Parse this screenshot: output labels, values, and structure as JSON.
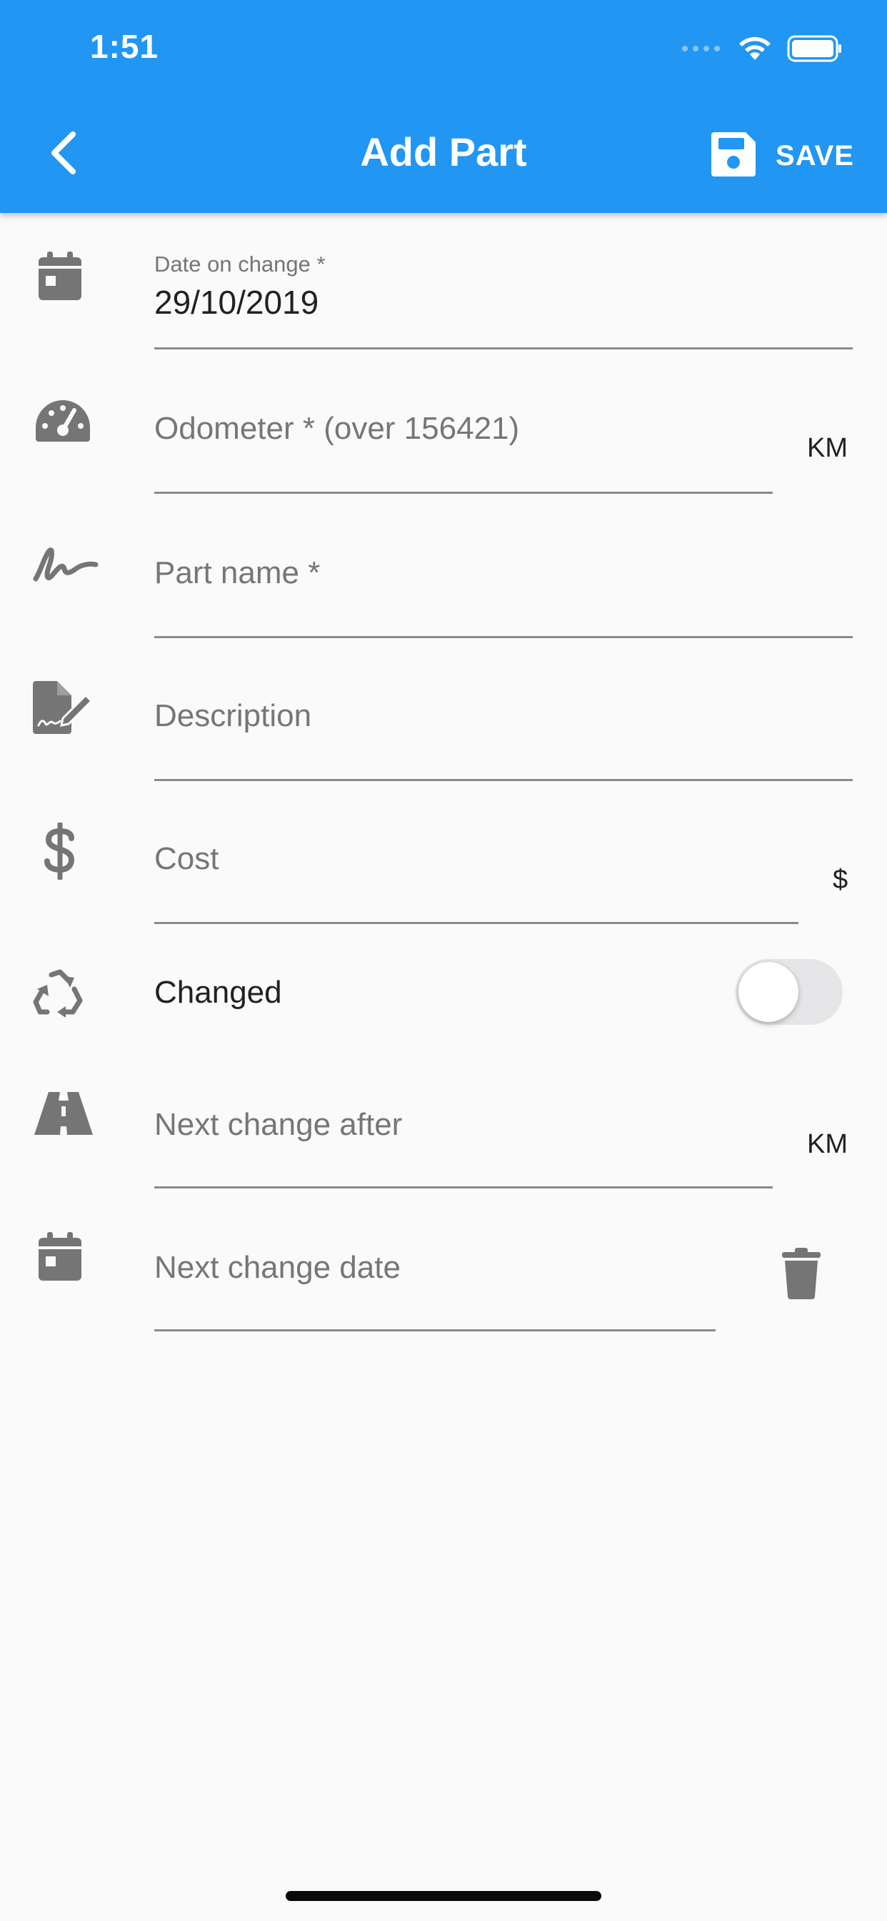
{
  "status_bar": {
    "time": "1:51"
  },
  "app_bar": {
    "title": "Add Part",
    "save_label": "SAVE",
    "back_icon": "chevron-left-icon",
    "save_icon": "floppy-disk-icon",
    "color": "#2196f3"
  },
  "form": {
    "date_on_change": {
      "label": "Date on change *",
      "value": "29/10/2019",
      "icon": "calendar-icon"
    },
    "odometer": {
      "placeholder": "Odometer * (over 156421)",
      "suffix": "KM",
      "icon": "speedometer-icon"
    },
    "part_name": {
      "placeholder": "Part name *",
      "icon": "signature-icon"
    },
    "description": {
      "placeholder": "Description",
      "icon": "file-signature-icon"
    },
    "cost": {
      "placeholder": "Cost",
      "suffix": "$",
      "icon": "dollar-icon"
    },
    "changed": {
      "label": "Changed",
      "checked": false,
      "icon": "recycle-icon"
    },
    "next_change_after": {
      "placeholder": "Next change after",
      "suffix": "KM",
      "icon": "road-icon"
    },
    "next_change_date": {
      "placeholder": "Next change date",
      "icon": "calendar-icon",
      "clear_icon": "trash-icon"
    }
  }
}
